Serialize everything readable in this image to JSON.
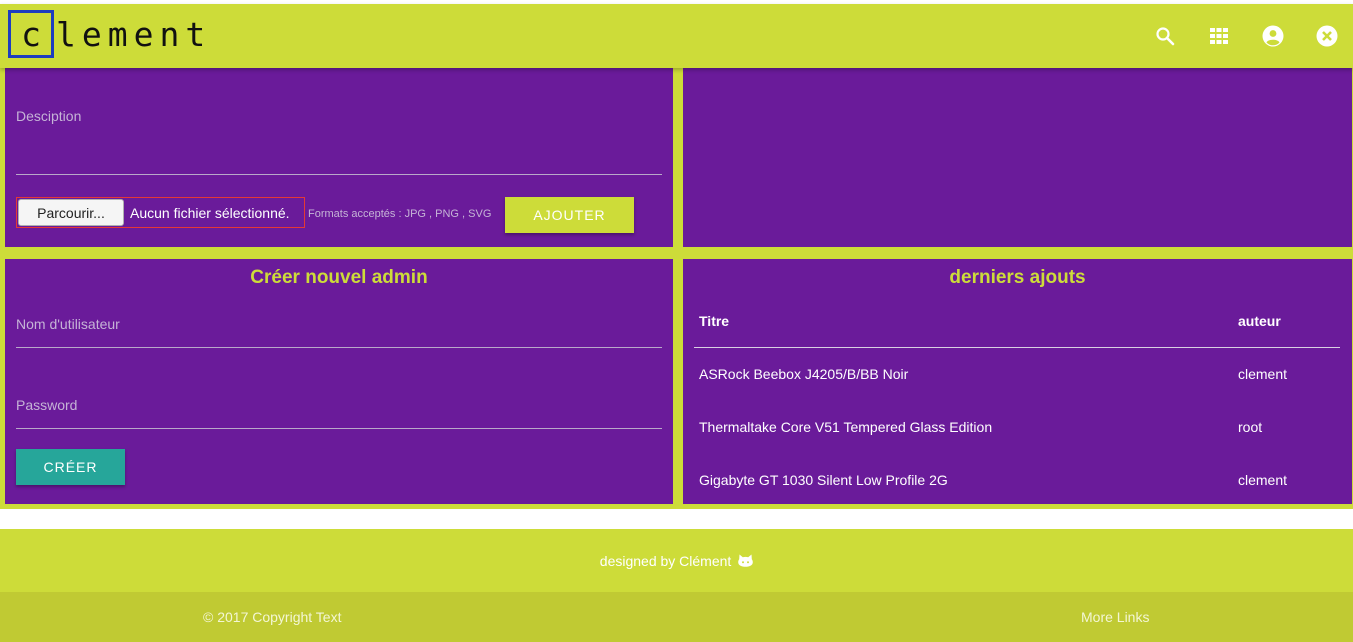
{
  "brand": {
    "first_letter": "c",
    "rest": "lement"
  },
  "nav": {
    "icons": [
      "search-icon",
      "apps-grid-icon",
      "account-circle-icon",
      "close-circle-icon"
    ]
  },
  "upload": {
    "description_label": "Desciption",
    "browse_label": "Parcourir...",
    "file_status": "Aucun fichier sélectionné.",
    "formats_hint": "Formats acceptés : JPG , PNG , SVG",
    "add_label": "AJOUTER"
  },
  "admin": {
    "title": "Créer nouvel admin",
    "username_label": "Nom d'utilisateur",
    "password_label": "Password",
    "create_label": "CRÉER"
  },
  "recent": {
    "title": "derniers ajouts",
    "columns": {
      "title": "Titre",
      "author": "auteur"
    },
    "rows": [
      {
        "title": "ASRock Beebox J4205/B/BB Noir",
        "author": "clement"
      },
      {
        "title": "Thermaltake Core V51 Tempered Glass Edition",
        "author": "root"
      },
      {
        "title": "Gigabyte GT 1030 Silent Low Profile 2G",
        "author": "clement"
      }
    ]
  },
  "footer": {
    "designed_by": "designed by Clément",
    "copyright": "© 2017 Copyright Text",
    "more_links": "More Links"
  },
  "colors": {
    "accent": "#cddc39",
    "card": "#6a1b9a",
    "teal": "#26a69a",
    "logo_border": "#1d3dbf"
  }
}
